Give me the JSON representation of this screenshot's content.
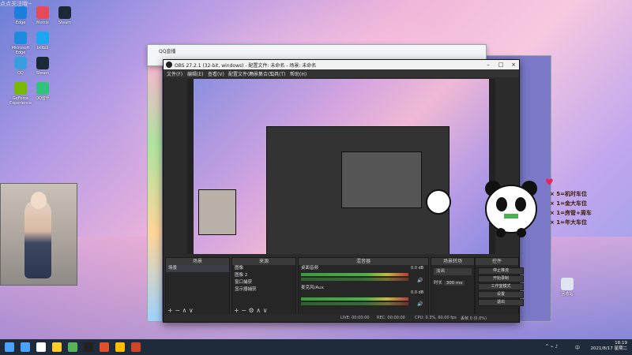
{
  "desktop": {
    "icons": [
      {
        "label": "Edge",
        "color": "#1d7fdc"
      },
      {
        "label": "Motrix",
        "color": "#e54a5a"
      },
      {
        "label": "Steam",
        "color": "#1b2838"
      },
      {
        "label": "Microsoft Edge",
        "color": "#1e8be0"
      },
      {
        "label": "bilibili",
        "color": "#1ba6ee"
      },
      {
        "label": "QQ",
        "color": "#3a9de0"
      },
      {
        "label": "Steam",
        "color": "#1b2838"
      },
      {
        "label": "GeForce Experience",
        "color": "#76b900"
      },
      {
        "label": "QQ音乐",
        "color": "#31c27c"
      }
    ],
    "recycle_bin": "回收站"
  },
  "qq_window": {
    "title": "QQ直播"
  },
  "obs": {
    "title": "OBS 27.2.1 (32-bit, windows) - 配置文件: 未命名 - 场景: 未命名",
    "menu": [
      "文件(F)",
      "编辑(E)",
      "查看(V)",
      "配置文件(P)",
      "场景集合(S)",
      "工具(T)",
      "帮助(H)"
    ],
    "docks": {
      "scenes": {
        "header": "场景",
        "items": [
          "场景"
        ]
      },
      "sources": {
        "header": "来源",
        "items": [
          "图像",
          "图像 2",
          "窗口捕获",
          "显示器捕获"
        ]
      },
      "mixer": {
        "header": "混音器",
        "channels": [
          {
            "name": "桌面音频",
            "db": "0.0 dB",
            "level": 0.75
          },
          {
            "name": "麦克风/Aux",
            "db": "0.0 dB",
            "level": 0.55
          }
        ]
      },
      "transitions": {
        "header": "场景转场",
        "type": "淡出",
        "duration_label": "时长",
        "duration": "300 ms"
      },
      "controls": {
        "header": "控件",
        "buttons": [
          "停止推流",
          "开始录制",
          "工作室模式",
          "设置",
          "退出"
        ]
      }
    },
    "status": {
      "live": "LIVE: 00:00:00",
      "rec": "REC: 00:00:00",
      "cpu": "CPU: 0.3%, 60.00 fps",
      "drop": "丢帧 0 (0.0%)"
    }
  },
  "overlay": {
    "title": "点点关注哦~",
    "rows": [
      "× 5=机时车位",
      "× 1=金大车位",
      "× 1=房管+周车",
      "× 1=年大车位"
    ]
  },
  "taskbar": {
    "time": "18:19",
    "date": "2021/8/17 星期二",
    "lang": "中",
    "icon_colors": [
      "#4ca3ff",
      "#ffffff",
      "#ffcc2a",
      "#5ab55a",
      "#222222",
      "#e0502d",
      "#ffbe00",
      "#d0442a"
    ]
  }
}
